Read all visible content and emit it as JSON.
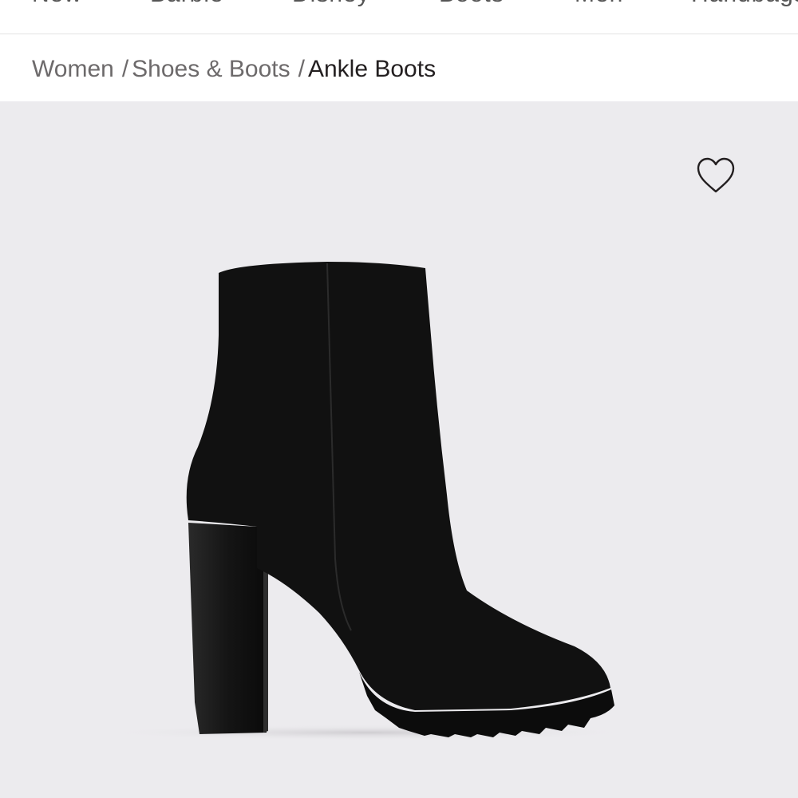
{
  "nav": {
    "items": [
      "New",
      "Barbie",
      "Disney",
      "Boots",
      "Men",
      "Handbags"
    ]
  },
  "breadcrumb": {
    "level1": "Women",
    "level2": "Shoes & Boots",
    "current": "Ankle Boots",
    "separator": "/"
  },
  "colors": {
    "stage_background": "#ecebee",
    "product": "#111111"
  },
  "icons": {
    "wishlist": "heart-outline-icon"
  }
}
